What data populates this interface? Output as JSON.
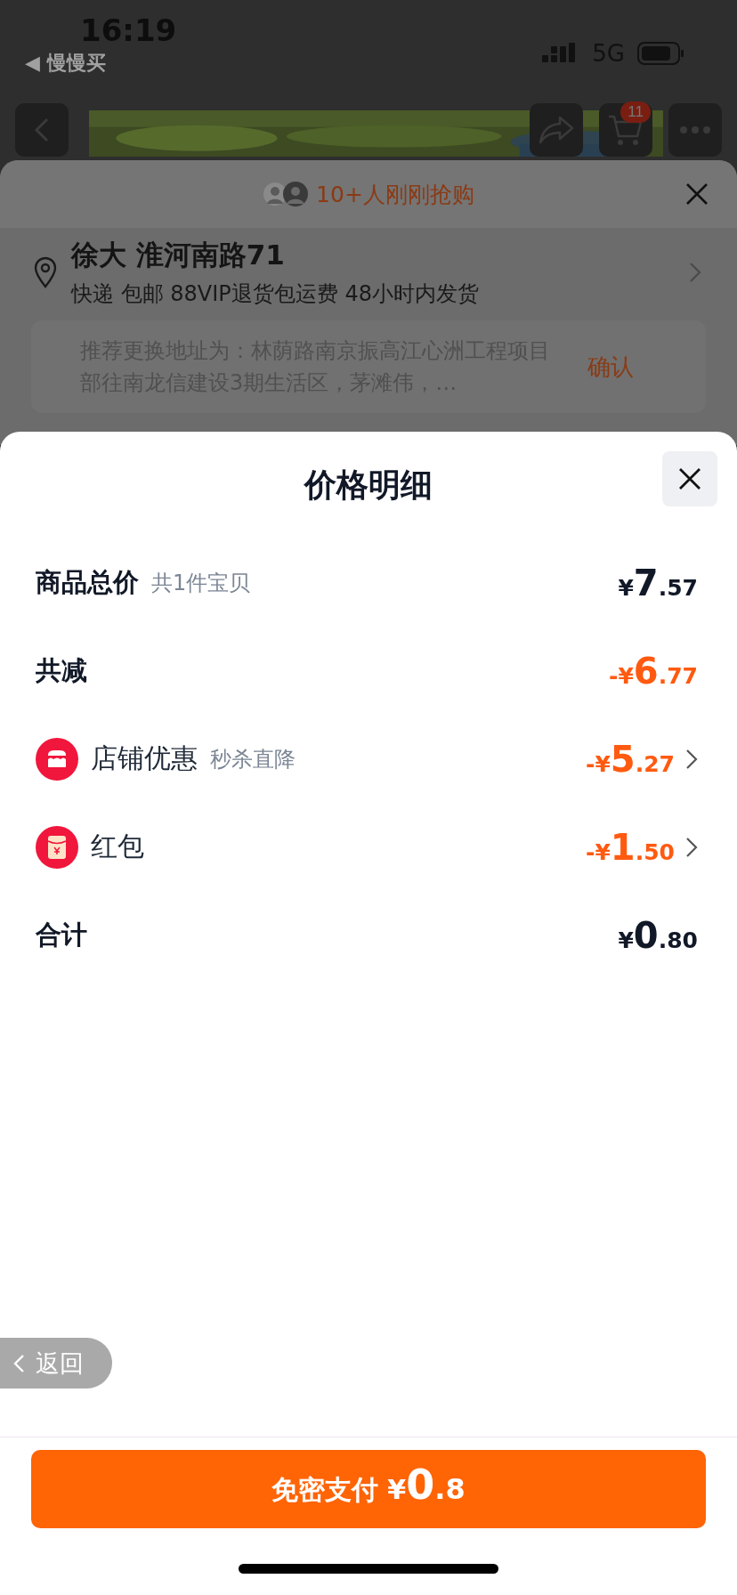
{
  "status_bar": {
    "time": "16:19",
    "back_app": "◀ 慢慢买",
    "network": "5G"
  },
  "top_nav": {
    "cart_badge": "11"
  },
  "background_sheet": {
    "buyers_text": "10+人刚刚抢购",
    "address_name": "徐大 淮河南路71",
    "shipping": "快递 包邮 88VIP退货包运费 48小时内发货",
    "suggestion": "推荐更换地址为：林荫路南京振高江心洲工程项目部往南龙信建设3期生活区，茅滩伟，…",
    "confirm": "确认"
  },
  "modal": {
    "title": "价格明细",
    "rows": [
      {
        "kind": "total",
        "label": "商品总价",
        "note": "共1件宝贝",
        "amount": {
          "prefix": "¥",
          "main": "7",
          "fraction": ".57"
        },
        "highlight": false
      },
      {
        "kind": "total",
        "label": "共减",
        "amount": {
          "prefix": "-¥",
          "main": "6",
          "fraction": ".77"
        },
        "highlight": true
      },
      {
        "kind": "shop",
        "label": "店铺优惠",
        "note": "秒杀直降",
        "amount": {
          "prefix": "-¥",
          "main": "5",
          "fraction": ".27"
        },
        "highlight": true
      },
      {
        "kind": "coupon",
        "label": "红包",
        "amount": {
          "prefix": "-¥",
          "main": "1",
          "fraction": ".50"
        },
        "highlight": true
      },
      {
        "kind": "total",
        "label": "合计",
        "amount": {
          "prefix": "¥",
          "main": "0",
          "fraction": ".80"
        },
        "highlight": false
      }
    ],
    "back_label": "返回",
    "pay_button": {
      "label": "免密支付",
      "prefix": "¥",
      "main": "0",
      "fraction": ".8"
    }
  }
}
